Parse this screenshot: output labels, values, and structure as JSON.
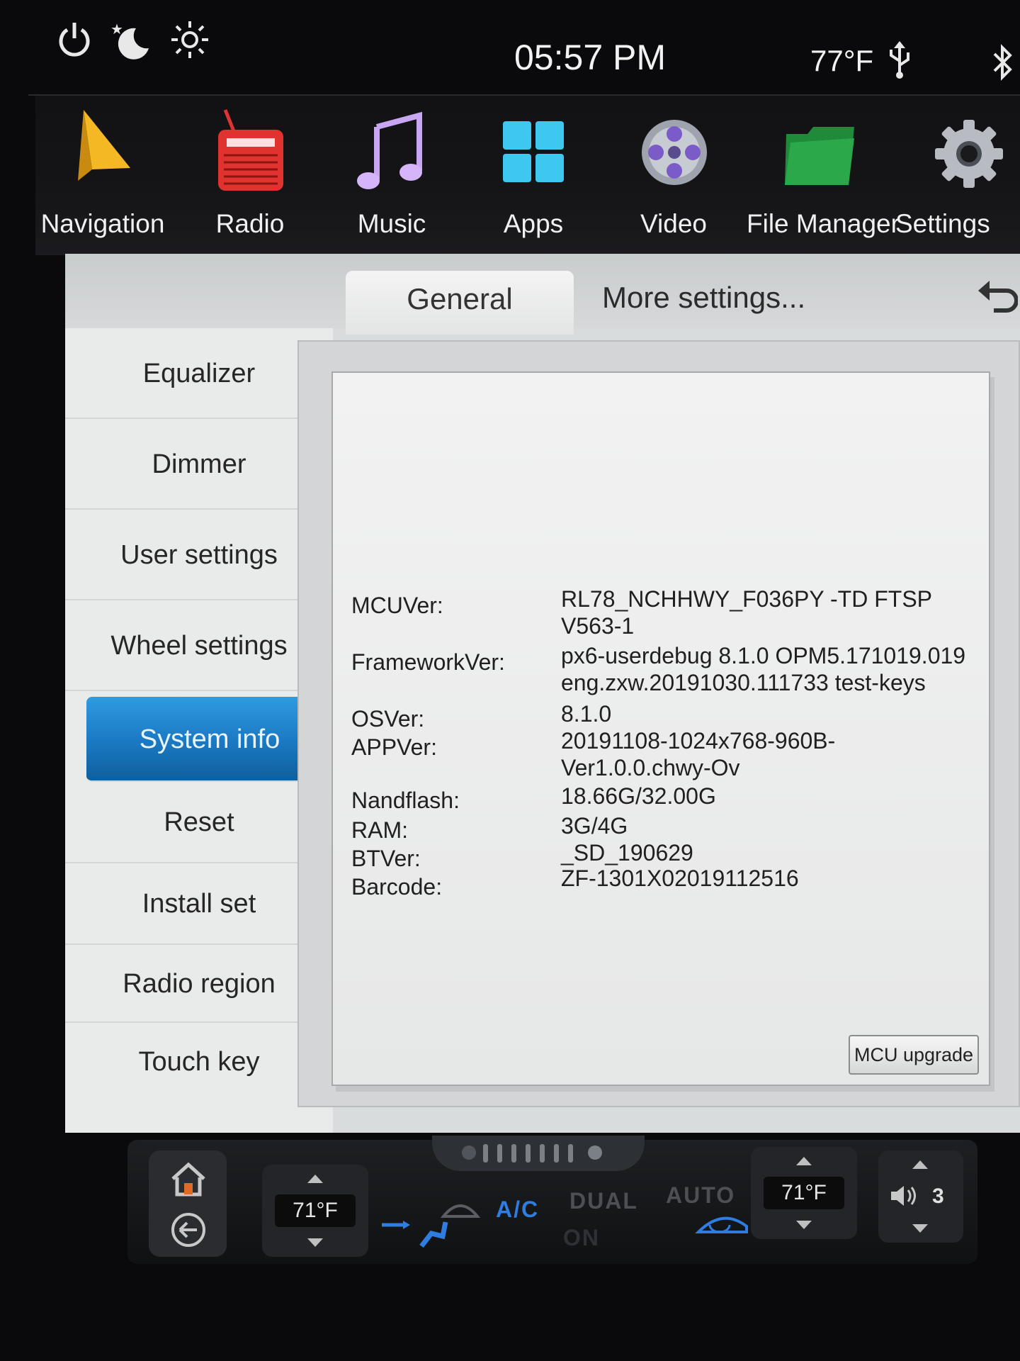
{
  "statusbar": {
    "time": "05:57 PM",
    "temperature": "77°F",
    "icons": [
      "power-icon",
      "night-mode-icon",
      "brightness-icon",
      "usb-icon",
      "bluetooth-icon"
    ]
  },
  "dock": {
    "items": [
      {
        "label": "Navigation",
        "icon": "navigation-arrow-icon"
      },
      {
        "label": "Radio",
        "icon": "radio-icon"
      },
      {
        "label": "Music",
        "icon": "music-note-icon"
      },
      {
        "label": "Apps",
        "icon": "apps-grid-icon"
      },
      {
        "label": "Video",
        "icon": "film-reel-icon"
      },
      {
        "label": "File Manager",
        "icon": "folder-icon"
      },
      {
        "label": "Settings",
        "icon": "gear-icon"
      }
    ]
  },
  "tabs": {
    "general": "General",
    "more": "More settings..."
  },
  "sidebar": {
    "items": [
      {
        "label": "Equalizer"
      },
      {
        "label": "Dimmer"
      },
      {
        "label": "User settings"
      },
      {
        "label": "Wheel settings"
      },
      {
        "label": "System info",
        "active": true
      },
      {
        "label": "Reset"
      },
      {
        "label": "Install set"
      },
      {
        "label": "Radio region"
      },
      {
        "label": "Touch key"
      }
    ]
  },
  "sysinfo": {
    "mcu_label": "MCUVer:",
    "mcu_value_1": "RL78_NCHHWY_F036PY   -TD FTSP",
    "mcu_value_2": "V563-1",
    "fw_label": "FrameworkVer:",
    "fw_value_1": "px6-userdebug 8.1.0 OPM5.171019.019",
    "fw_value_2": "eng.zxw.20191030.111733 test-keys",
    "os_label": "OSVer:",
    "os_value": "8.1.0",
    "app_label": "APPVer:",
    "app_value_1": "20191108-1024x768-960B-",
    "app_value_2": "Ver1.0.0.chwy-Ov",
    "nand_label": "Nandflash:",
    "nand_value": "18.66G/32.00G",
    "ram_label": "RAM:",
    "ram_value": "3G/4G",
    "bt_label": "BTVer:",
    "bt_value": "_SD_190629",
    "barcode_label": "Barcode:",
    "barcode_value": "ZF-1301X02019112516",
    "mcu_upgrade": "MCU upgrade"
  },
  "climate": {
    "left_temp": "71°F",
    "right_temp": "71°F",
    "ac": "A/C",
    "dual": "DUAL",
    "auto": "AUTO",
    "on": "ON",
    "volume": "3"
  },
  "colors": {
    "active_tab": "#1a78c2",
    "ac_blue": "#2f7de0",
    "panel_bg": "#eeeeee"
  }
}
